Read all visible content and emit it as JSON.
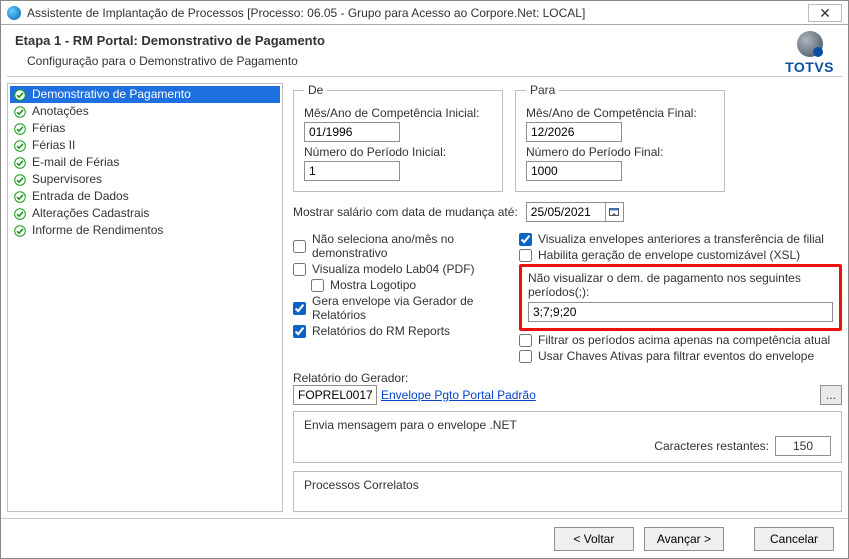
{
  "window_title": "Assistente de Implantação de Processos [Processo: 06.05 - Grupo para Acesso ao Corpore.Net: LOCAL]",
  "close_glyph": "✕",
  "header": {
    "step_title": "Etapa 1 - RM Portal: Demonstrativo de Pagamento",
    "subtitle": "Configuração para o Demonstrativo de Pagamento",
    "brand": "TOTVS"
  },
  "nav": {
    "items": [
      {
        "label": "Demonstrativo de Pagamento",
        "selected": true
      },
      {
        "label": "Anotações"
      },
      {
        "label": "Férias"
      },
      {
        "label": "Férias II"
      },
      {
        "label": "E-mail de Férias"
      },
      {
        "label": "Supervisores"
      },
      {
        "label": "Entrada de Dados"
      },
      {
        "label": "Alterações Cadastrais"
      },
      {
        "label": "Informe de Rendimentos"
      }
    ]
  },
  "de": {
    "legend": "De",
    "mes_label": "Mês/Ano de Competência Inicial:",
    "mes_value": "01/1996",
    "periodo_label": "Número do Período Inicial:",
    "periodo_value": "1"
  },
  "para": {
    "legend": "Para",
    "mes_label": "Mês/Ano de Competência Final:",
    "mes_value": "12/2026",
    "periodo_label": "Número do Período Final:",
    "periodo_value": "1000"
  },
  "mostrar_salario_label": "Mostrar salário com data de mudança até:",
  "mostrar_salario_value": "25/05/2021",
  "checks_left": {
    "nao_seleciona": "Não seleciona ano/mês no demonstrativo",
    "visualiza_lab04": "Visualiza modelo Lab04 (PDF)",
    "mostra_logotipo": "Mostra Logotipo",
    "gera_envelope": "Gera envelope via Gerador de Relatórios",
    "relatorios_rm": "Relatórios do RM Reports"
  },
  "checks_right": {
    "visualiza_env_ant": "Visualiza envelopes anteriores a transferência de filial",
    "habilita_xsl": "Habilita geração de envelope customizável (XSL)",
    "filtrar_periodos": "Filtrar os períodos acima apenas na competência atual",
    "usar_chaves": "Usar Chaves Ativas para filtrar eventos do envelope"
  },
  "highlight": {
    "label": "Não visualizar o dem. de pagamento nos seguintes períodos(;):",
    "value": "3;7;9;20"
  },
  "gerador": {
    "label": "Relatório do Gerador:",
    "code": "FOPREL0017",
    "link": "Envelope Pgto Portal Padrão",
    "btn": "..."
  },
  "envnet": {
    "label": "Envia mensagem para o envelope .NET",
    "restantes_label": "Caracteres restantes:",
    "restantes_value": "150"
  },
  "proc_label": "Processos Correlatos",
  "footer": {
    "voltar": "< Voltar",
    "avancar": "Avançar >",
    "cancelar": "Cancelar"
  }
}
